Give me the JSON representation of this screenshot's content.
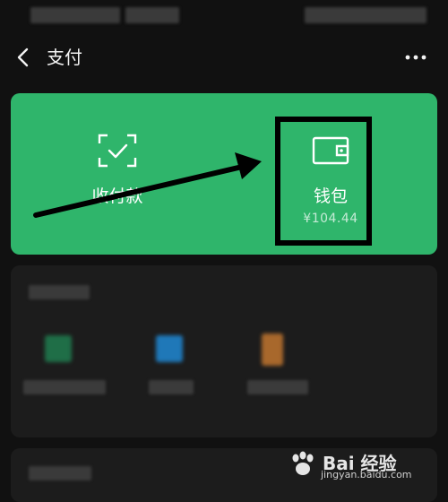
{
  "nav": {
    "title": "支付"
  },
  "pay_card": {
    "collect_label": "收付款",
    "wallet_label": "钱包",
    "wallet_balance": "¥104.44"
  },
  "watermark": {
    "brand": "Bai 经验",
    "url": "jingyan.baidu.com"
  },
  "colors": {
    "card_green": "#2fb56b",
    "background": "#111111",
    "section": "#1c1c1c"
  },
  "icons": {
    "back": "chevron-left-icon",
    "more": "more-dots-icon",
    "collect": "scan-qr-icon",
    "wallet": "wallet-icon"
  }
}
